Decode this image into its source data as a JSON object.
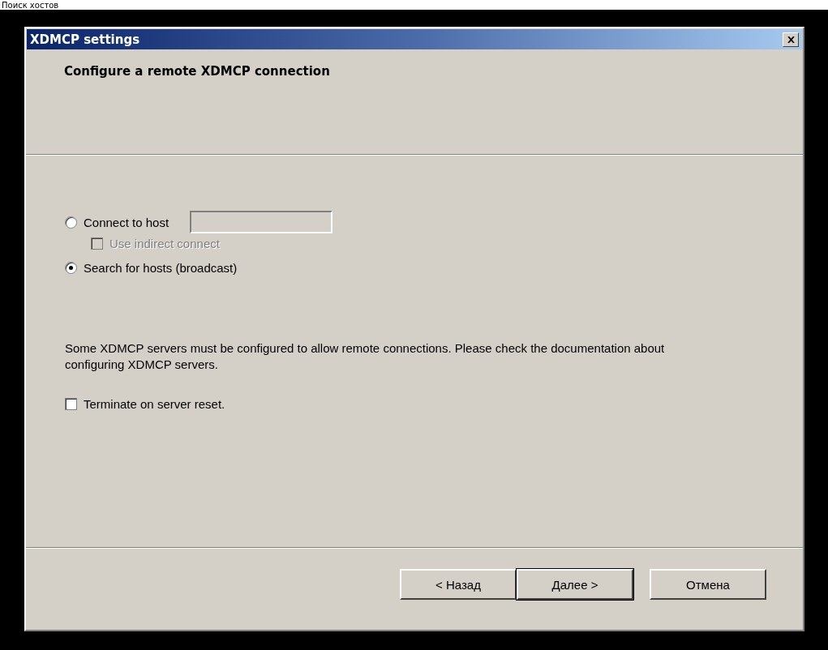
{
  "page_caption": "Поиск хостов",
  "window": {
    "title": "XDMCP settings"
  },
  "header": {
    "title": "Configure a remote XDMCP connection"
  },
  "modes": [
    {
      "kind": "radio-field",
      "label": "Connect to host",
      "selected": false,
      "children": [
        {
          "kind": "checkbox",
          "label": "Use indirect connect",
          "checked": false,
          "disabled": true
        }
      ]
    },
    {
      "kind": "radio",
      "label": "Search for hosts (broadcast)",
      "selected": true
    }
  ],
  "note": "Some XDMCP servers must be configured to allow remote connections. Please check the documentation about configuring XDMCP servers.",
  "options": [
    {
      "kind": "checkbox",
      "label": "Terminate on server reset.",
      "checked": false,
      "disabled": false
    }
  ],
  "buttons": [
    {
      "label": "< Назад",
      "default": false
    },
    {
      "label": "Далее >",
      "default": true
    },
    {
      "label": "Отмена",
      "default": false
    }
  ]
}
